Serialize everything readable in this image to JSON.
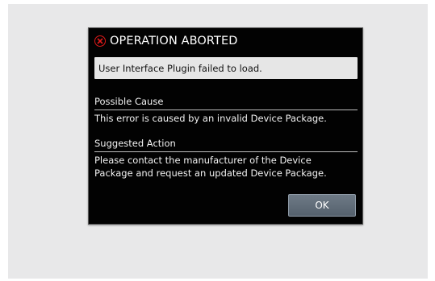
{
  "dialog": {
    "title": "OPERATION ABORTED",
    "icon": "error-circle-icon",
    "message": "User Interface Plugin failed to load.",
    "possible_cause": {
      "heading": "Possible Cause",
      "text": "This error is caused by an invalid Device Package."
    },
    "suggested_action": {
      "heading": "Suggested Action",
      "line1": "Please contact the manufacturer of the Device",
      "line2": "Package and request an updated Device Package."
    },
    "ok_label": "OK"
  },
  "colors": {
    "dialog_background": "#020202",
    "error_icon": "#e01a1a",
    "message_background": "#e6e6e6",
    "button_background": "#5f6b77",
    "page_background": "#e8e8e9"
  }
}
